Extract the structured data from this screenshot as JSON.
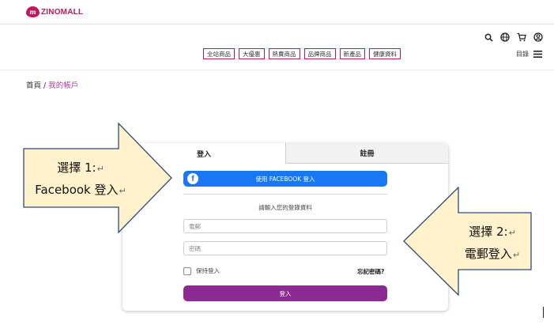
{
  "brand": {
    "logo_mark": "m",
    "name": "ZINOMALL"
  },
  "nav": {
    "items": [
      {
        "label": "全站商品"
      },
      {
        "label": "大優惠"
      },
      {
        "label": "熱賣商品"
      },
      {
        "label": "品牌商品"
      },
      {
        "label": "新產品"
      },
      {
        "label": "健康資料"
      }
    ]
  },
  "header_icons": [
    "search-icon",
    "globe-icon",
    "cart-icon",
    "user-icon"
  ],
  "menu": {
    "label": "目錄"
  },
  "breadcrumb": {
    "home": "首頁",
    "separator": "/",
    "current": "我的帳戶"
  },
  "auth": {
    "tabs": [
      {
        "label": "登入"
      },
      {
        "label": "註冊"
      }
    ],
    "facebook_button": "使用 FACEBOOK 登入",
    "prompt": "請輸入您的登錄資料",
    "email_placeholder": "電郵",
    "password_placeholder": "密碼",
    "remember_label": "保持登入",
    "forgot_label": "忘記密碼?",
    "submit_label": "登入"
  },
  "annotations": {
    "left": {
      "line1": "選擇 1:",
      "line2": "Facebook 登入",
      "return_mark": "↵"
    },
    "right": {
      "line1": "選擇 2:",
      "line2": "電郵登入",
      "return_mark": "↵"
    }
  },
  "colors": {
    "brand": "#c2185b",
    "facebook": "#1877f2",
    "submit": "#8b2a93",
    "callout_fill": "#fff2cc",
    "callout_stroke": "#2f4b7c"
  }
}
